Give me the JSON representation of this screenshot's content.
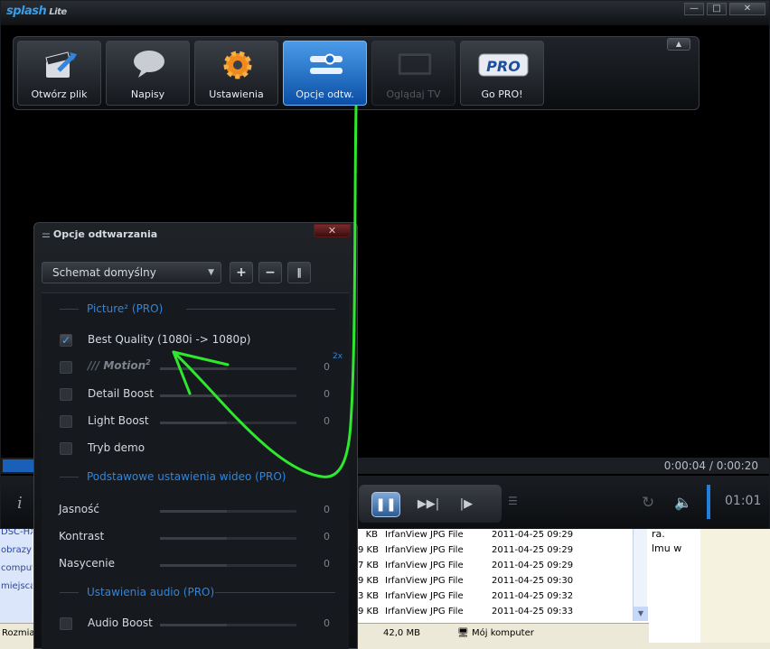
{
  "window": {
    "logo": "splash",
    "logo_suffix": "Lite",
    "minimize": "—",
    "maximize": "□",
    "close": "✕"
  },
  "toolbar": {
    "items": [
      {
        "label": "Otwórz plik",
        "icon": "clapperboard-icon"
      },
      {
        "label": "Napisy",
        "icon": "speech-bubble-icon"
      },
      {
        "label": "Ustawienia",
        "icon": "gear-icon"
      },
      {
        "label": "Opcje odtw.",
        "icon": "playback-options-icon",
        "active": true
      },
      {
        "label": "Oglądaj TV",
        "icon": "tv-icon",
        "disabled": true
      },
      {
        "label": "Go PRO!",
        "icon": "pro-badge-icon",
        "badge": "PRO"
      }
    ],
    "collapse": "▲"
  },
  "progress": {
    "time": "0:00:04 / 0:00:20"
  },
  "controls": {
    "info": "i",
    "pause": "❚❚",
    "next": "▶▶|",
    "step": "|▶",
    "clock": "01:01"
  },
  "panel": {
    "title": "Opcje odtwarzania",
    "close": "✕",
    "schema": "Schemat domyślny",
    "add": "+",
    "remove": "−",
    "split": "‖",
    "sections": {
      "picture": "Picture² (PRO)",
      "video": "Podstawowe ustawienia wideo (PRO)",
      "audio": "Ustawienia audio (PRO)"
    },
    "best_quality": "Best Quality (1080i -> 1080p)",
    "motion": "Motion",
    "motion_sup": "2",
    "motion_value": "0",
    "motion_2x": "2x",
    "detail_boost": "Detail Boost",
    "detail_value": "0",
    "light_boost": "Light Boost",
    "light_value": "0",
    "demo": "Tryb demo",
    "brightness": "Jasność",
    "brightness_value": "0",
    "contrast": "Kontrast",
    "contrast_value": "0",
    "saturation": "Nasycenie",
    "saturation_value": "0",
    "audio_boost": "Audio Boost",
    "audio_value": "0"
  },
  "explorer": {
    "left_items": [
      "DSC-HX",
      "obrazy",
      "computer",
      "miejsca"
    ],
    "rows": [
      {
        "size": "KB",
        "type": "IrfanView JPG File",
        "date": "2011-04-25 09:29"
      },
      {
        "size": "9 KB",
        "type": "IrfanView JPG File",
        "date": "2011-04-25 09:29"
      },
      {
        "size": "7 KB",
        "type": "IrfanView JPG File",
        "date": "2011-04-25 09:29"
      },
      {
        "size": "9 KB",
        "type": "IrfanView JPG File",
        "date": "2011-04-25 09:30"
      },
      {
        "size": "3 KB",
        "type": "IrfanView JPG File",
        "date": "2011-04-25 09:32"
      },
      {
        "size": "9 KB",
        "type": "IrfanView JPG File",
        "date": "2011-04-25 09:33"
      }
    ],
    "side_text_1": "ra.",
    "side_text_2": "lmu w",
    "status_left": "Rozmia",
    "status_size": "42,0 MB",
    "status_location": "Mój komputer"
  }
}
